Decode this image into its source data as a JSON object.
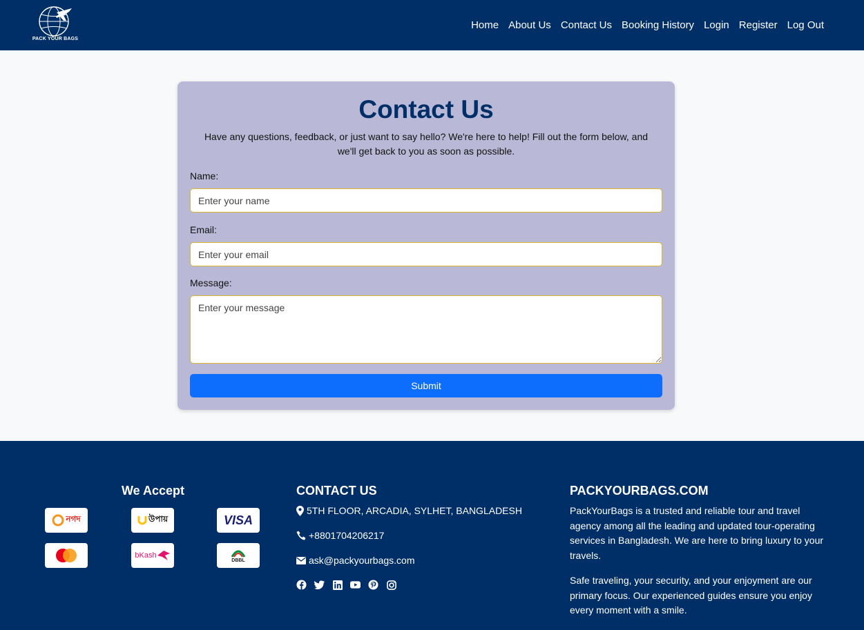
{
  "brand": {
    "logo_text": "PACK YOUR BAGS"
  },
  "nav": [
    "Home",
    "About Us",
    "Contact Us",
    "Booking History",
    "Login",
    "Register",
    "Log Out"
  ],
  "contact_form": {
    "title": "Contact Us",
    "intro": "Have any questions, feedback, or just want to say hello? We're here to help! Fill out the form below, and we'll get back to you as soon as possible.",
    "name_label": "Name:",
    "name_placeholder": "Enter your name",
    "email_label": "Email:",
    "email_placeholder": "Enter your email",
    "message_label": "Message:",
    "message_placeholder": "Enter your message",
    "submit_label": "Submit"
  },
  "footer": {
    "accept_title": "We Accept",
    "payment_methods": [
      {
        "name": "nagad",
        "text": "নগদ",
        "color": "#e2231a"
      },
      {
        "name": "upay",
        "text": "উপায়",
        "color": "#1a1a1a"
      },
      {
        "name": "visa",
        "text": "VISA",
        "color": "#1a1f71"
      },
      {
        "name": "mastercard",
        "text": "",
        "color": "#eb001b"
      },
      {
        "name": "bkash",
        "text": "bKash",
        "color": "#e2136e"
      },
      {
        "name": "dbbl",
        "text": "DBBL",
        "color": "#1a1a1a"
      }
    ],
    "contact_title": "CONTACT US",
    "address": "5TH FLOOR, ARCADIA, SYLHET, BANGLADESH",
    "phone": "+8801704206217",
    "email": "ask@packyourbags.com",
    "socials": [
      "facebook-icon",
      "twitter-icon",
      "linkedin-icon",
      "youtube-icon",
      "pinterest-icon",
      "instagram-icon"
    ],
    "brand_title": "PACKYOURBAGS.COM",
    "brand_p1": "PackYourBags is a trusted and reliable tour and travel agency among all the leading and updated tour-operating services in Bangladesh. We are here to bring luxury to your travels.",
    "brand_p2": "Safe traveling, your security, and your enjoyment are our primary focus. Our experienced guides ensure you enjoy every moment with a smile."
  },
  "colors": {
    "navy": "#002e66",
    "card": "#b9b8d6",
    "primary": "#0d6efd",
    "field_border": "#d9b830"
  }
}
